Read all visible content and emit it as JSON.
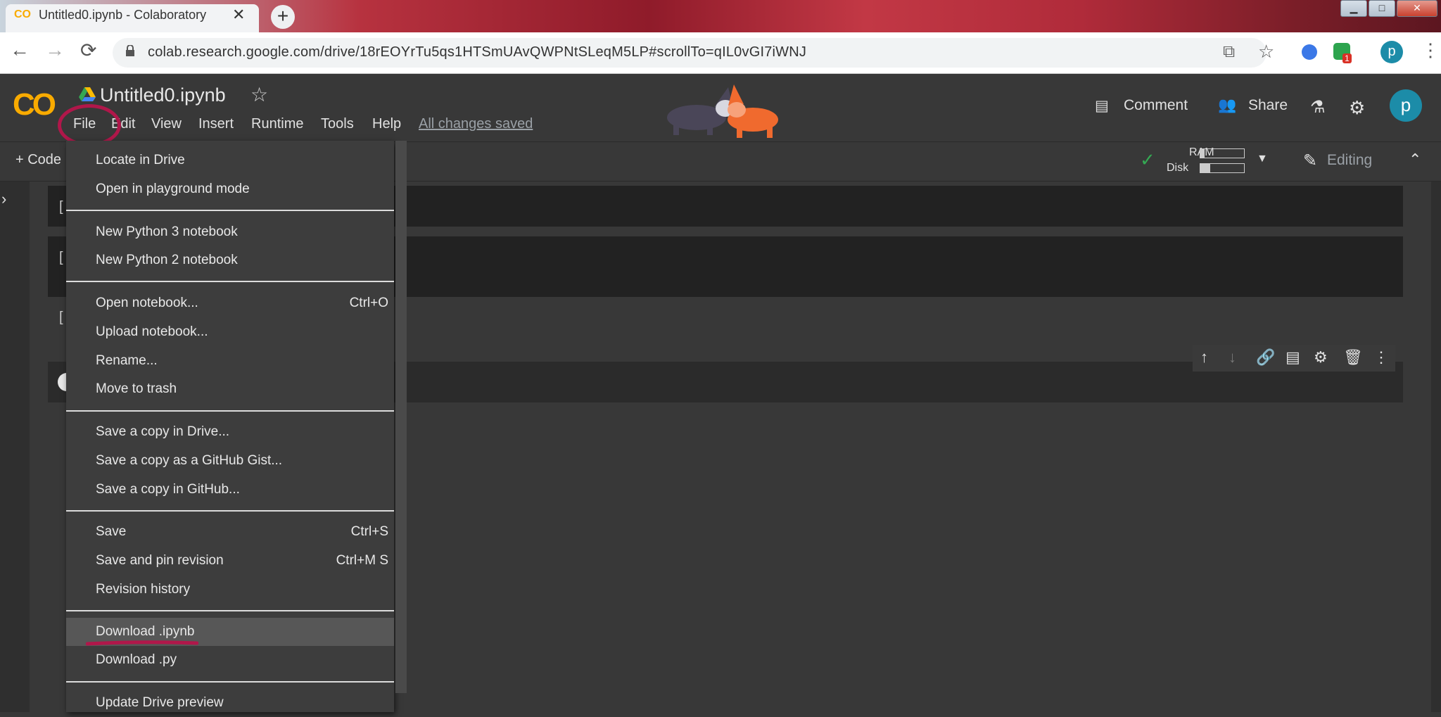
{
  "browser": {
    "tab_title": "Untitled0.ipynb - Colaboratory",
    "tab_favicon": "CO",
    "url": "colab.research.google.com/drive/18rEOYrTu5qs1HTSmUAvQWPNtSLeqM5LP#scrollTo=qIL0vGI7iWNJ",
    "new_tab": "+",
    "extension_badge": "1",
    "profile_initial": "p"
  },
  "colab": {
    "logo": "CO",
    "notebook_title": "Untitled0.ipynb",
    "menus": [
      "File",
      "Edit",
      "View",
      "Insert",
      "Runtime",
      "Tools",
      "Help"
    ],
    "save_status": "All changes saved",
    "comment_label": "Comment",
    "share_label": "Share",
    "avatar_initial": "p",
    "code_button": "+ Code",
    "ram_label": "RAM",
    "disk_label": "Disk",
    "editing_label": "Editing"
  },
  "file_menu": {
    "items": [
      {
        "label": "Locate in Drive",
        "shortcut": ""
      },
      {
        "label": "Open in playground mode",
        "shortcut": ""
      },
      {
        "label": "New Python 3 notebook",
        "shortcut": ""
      },
      {
        "label": "New Python 2 notebook",
        "shortcut": ""
      },
      {
        "label": "Open notebook...",
        "shortcut": "Ctrl+O"
      },
      {
        "label": "Upload notebook...",
        "shortcut": ""
      },
      {
        "label": "Rename...",
        "shortcut": ""
      },
      {
        "label": "Move to trash",
        "shortcut": ""
      },
      {
        "label": "Save a copy in Drive...",
        "shortcut": ""
      },
      {
        "label": "Save a copy as a GitHub Gist...",
        "shortcut": ""
      },
      {
        "label": "Save a copy in GitHub...",
        "shortcut": ""
      },
      {
        "label": "Save",
        "shortcut": "Ctrl+S"
      },
      {
        "label": "Save and pin revision",
        "shortcut": "Ctrl+M S"
      },
      {
        "label": "Revision history",
        "shortcut": ""
      },
      {
        "label": "Download .ipynb",
        "shortcut": ""
      },
      {
        "label": "Download .py",
        "shortcut": ""
      },
      {
        "label": "Update Drive preview",
        "shortcut": ""
      }
    ],
    "highlighted_item": "Download .ipynb"
  },
  "colors": {
    "accent": "#f9ab00",
    "annotation": "#b0174a",
    "avatar": "#1c8ca8"
  }
}
